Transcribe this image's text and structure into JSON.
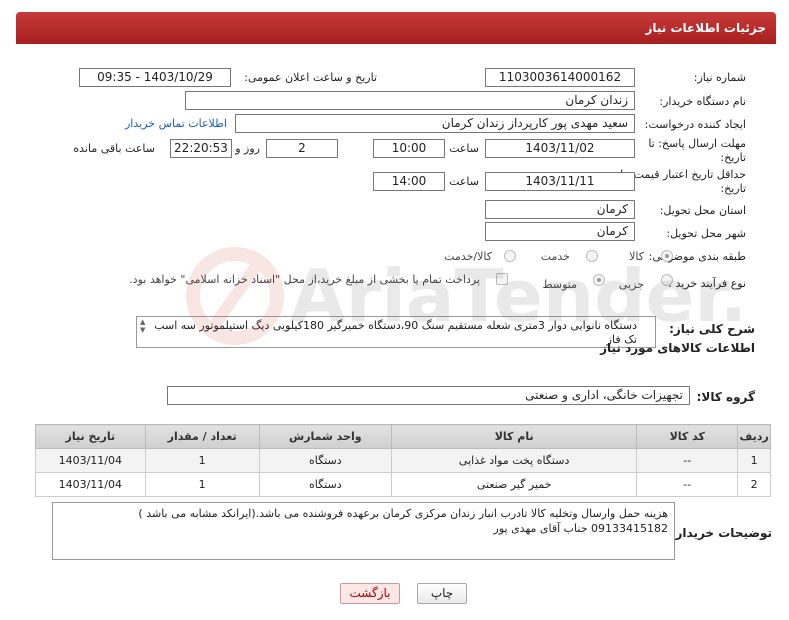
{
  "header": {
    "title": "جزئیات اطلاعات نیاز"
  },
  "fields": {
    "need_number_label": "شماره نیاز:",
    "need_number": "1103003614000162",
    "announce_label": "تاریخ و ساعت اعلان عمومی:",
    "announce_value": "1403/10/29 - 09:35",
    "buyer_org_label": "نام دستگاه خریدار:",
    "buyer_org": "زندان کرمان",
    "creator_label": "ایجاد کننده درخواست:",
    "creator": "سعید مهدی پور کارپرداز زندان کرمان",
    "contact_link": "اطلاعات تماس خریدار",
    "deadline_label_1": "مهلت ارسال پاسخ: تا",
    "deadline_label_2": "تاریخ:",
    "deadline_date": "1403/11/02",
    "time_label": "ساعت",
    "deadline_time": "10:00",
    "days_value": "2",
    "days_label": "روز و",
    "remaining_value": "22:20:53",
    "remaining_label": "ساعت باقی مانده",
    "validity_label_1": "حداقل تاریخ اعتبار قیمت: تا",
    "validity_label_2": "تاریخ:",
    "validity_date": "1403/11/11",
    "validity_time": "14:00",
    "province_label": "استان محل تحویل:",
    "province": "کرمان",
    "city_label": "شهر محل تحویل:",
    "city": "کرمان",
    "category_label": "طبقه بندی موضوعی:",
    "category_options": [
      "کالا",
      "خدمت",
      "کالا/خدمت"
    ],
    "process_label": "نوع فرآیند خرید :",
    "process_options": [
      "جزیی",
      "متوسط"
    ],
    "payment_note": "پرداخت تمام یا بخشی از مبلغ خرید،از محل \"اسناد خزانه اسلامی\" خواهد بود."
  },
  "description": {
    "label": "شرح کلی نیاز:",
    "text": "دستگاه نانوایی دوار 3متری شعله مستقیم سنگ 90،دستگاه خمیرگیر 180کیلویی دیگ استیلموتور سه اسب تک فاز"
  },
  "goods": {
    "section_title": "اطلاعات کالاهای مورد نیاز",
    "group_label": "گروه کالا:",
    "group_value": "تجهیزات خانگی، اداری و صنعتی",
    "columns": [
      "ردیف",
      "کد کالا",
      "نام کالا",
      "واحد شمارش",
      "تعداد / مقدار",
      "تاریخ نیاز"
    ],
    "rows": [
      [
        "1",
        "--",
        "دستگاه پخت مواد غذایی",
        "دستگاه",
        "1",
        "1403/11/04"
      ],
      [
        "2",
        "--",
        "خمیر گیر صنعتی",
        "دستگاه",
        "1",
        "1403/11/04"
      ]
    ]
  },
  "notes": {
    "label": "توضیحات خریدار:",
    "text": "هزینه حمل وارسال وتخلیه کالا تادرب انبار زندان مرکزی کرمان برعهده فروشنده می باشد.(ایرانکد مشابه می باشد ) 09133415182 جناب آقای مهدی پور"
  },
  "buttons": {
    "print": "چاپ",
    "back": "بازگشت"
  },
  "watermark": "AriaTender.neT"
}
